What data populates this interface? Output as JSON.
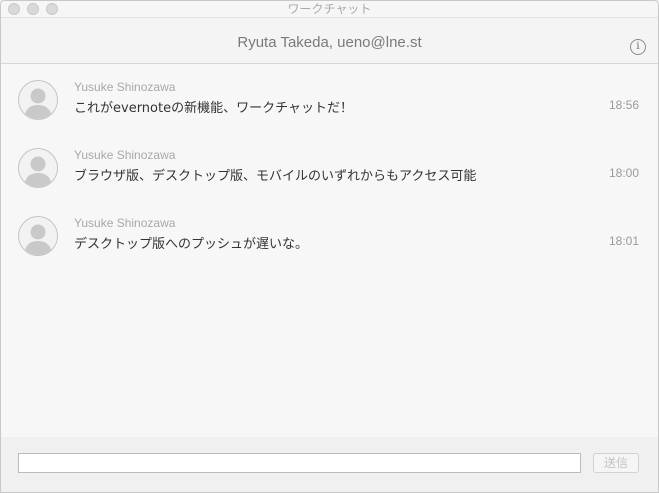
{
  "window": {
    "title": "ワークチャット"
  },
  "header": {
    "title": "Ryuta Takeda, ueno@lne.st",
    "info_icon": "info-icon",
    "info_glyph": "i"
  },
  "messages": [
    {
      "sender": "Yusuke Shinozawa",
      "text": "これがevernoteの新機能、ワークチャットだ！",
      "time": "18:56",
      "avatar_icon": "default-user-avatar-icon"
    },
    {
      "sender": "Yusuke Shinozawa",
      "text": "ブラウザ版、デスクトップ版、モバイルのいずれからもアクセス可能",
      "time": "18:00",
      "avatar_icon": "default-user-avatar-icon"
    },
    {
      "sender": "Yusuke Shinozawa",
      "text": "デスクトップ版へのプッシュが遅いな。",
      "time": "18:01",
      "avatar_icon": "default-user-avatar-icon"
    }
  ],
  "composer": {
    "input_value": "",
    "input_placeholder": "",
    "send_label": "送信"
  },
  "colors": {
    "background": "#f7f7f7",
    "sender_text": "#a8a8a8",
    "message_text": "#333333",
    "time_text": "#9a9a9a"
  }
}
